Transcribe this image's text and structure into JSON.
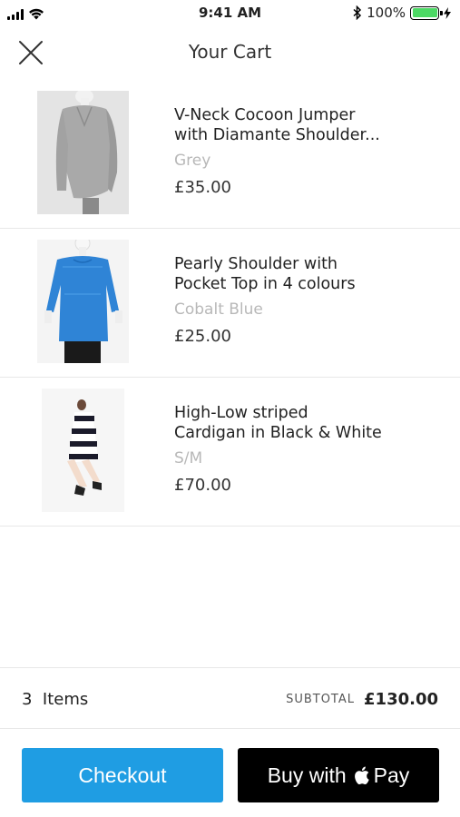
{
  "status_bar": {
    "time": "9:41 AM",
    "battery": "100%",
    "battery_level": 1.0
  },
  "header": {
    "title": "Your Cart"
  },
  "cart": {
    "items": [
      {
        "name_line1": "V-Neck Cocoon Jumper",
        "name_line2": "with Diamante Shoulder...",
        "variant": "Grey",
        "price": "£35.00"
      },
      {
        "name_line1": "Pearly Shoulder with",
        "name_line2": "Pocket Top in 4 colours",
        "variant": "Cobalt Blue",
        "price": "£25.00"
      },
      {
        "name_line1": "High-Low striped",
        "name_line2": "Cardigan in Black & White",
        "variant": "S/M",
        "price": "£70.00"
      }
    ]
  },
  "summary": {
    "items_count": "3  Items",
    "subtotal_label": "SUBTOTAL",
    "subtotal_value": "£130.00"
  },
  "actions": {
    "checkout_label": "Checkout",
    "buy_with_label": "Buy with",
    "pay_label": "Pay"
  },
  "colors": {
    "checkout_bg": "#1f9de3",
    "applepay_bg": "#000000",
    "battery_fill": "#4cd964",
    "variant_text": "#b8b8b8"
  }
}
